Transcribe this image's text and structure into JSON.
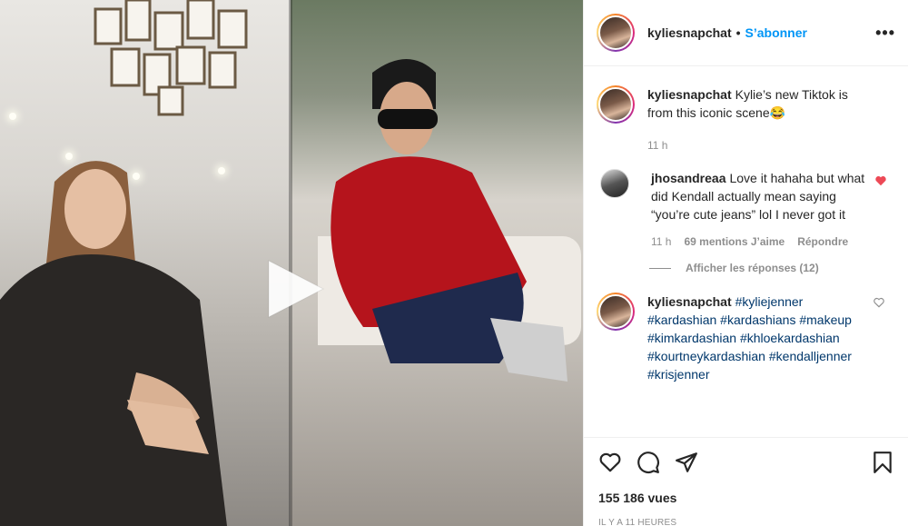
{
  "post": {
    "username": "kyliesnapchat",
    "separator": "•",
    "follow_label": "S’abonner",
    "more_label": "•••"
  },
  "caption": {
    "author": "kyliesnapchat",
    "text": "Kylie’s new Tiktok is from this iconic scene😂",
    "time": "11 h"
  },
  "comments": [
    {
      "author": "jhosandreaa",
      "text": "Love it hahaha but what did Kendall actually mean saying “you’re cute jeans” lol I never got it",
      "time": "11 h",
      "likes": "69 mentions J’aime",
      "reply_label": "Répondre",
      "view_replies": "Afficher les réponses (12)"
    },
    {
      "author": "kyliesnapchat",
      "hashtags": [
        "#kyliejenner",
        "#kardashian",
        "#kardashians",
        "#makeup",
        "#kimkardashian",
        "#khloekardashian",
        "#kourtneykardashian",
        "#kendalljenner",
        "#krisjenner"
      ]
    }
  ],
  "footer": {
    "views": "155 186 vues",
    "timestamp": "IL Y A 11 HEURES"
  },
  "colors": {
    "accent": "#0095f6",
    "like_red": "#ed4956",
    "muted": "#8e8e8e",
    "hashtag": "#00376b"
  },
  "icons": {
    "play": "play-icon",
    "heart": "heart-icon",
    "comment": "comment-icon",
    "share": "share-icon",
    "save": "bookmark-icon",
    "more": "more-options-icon"
  }
}
